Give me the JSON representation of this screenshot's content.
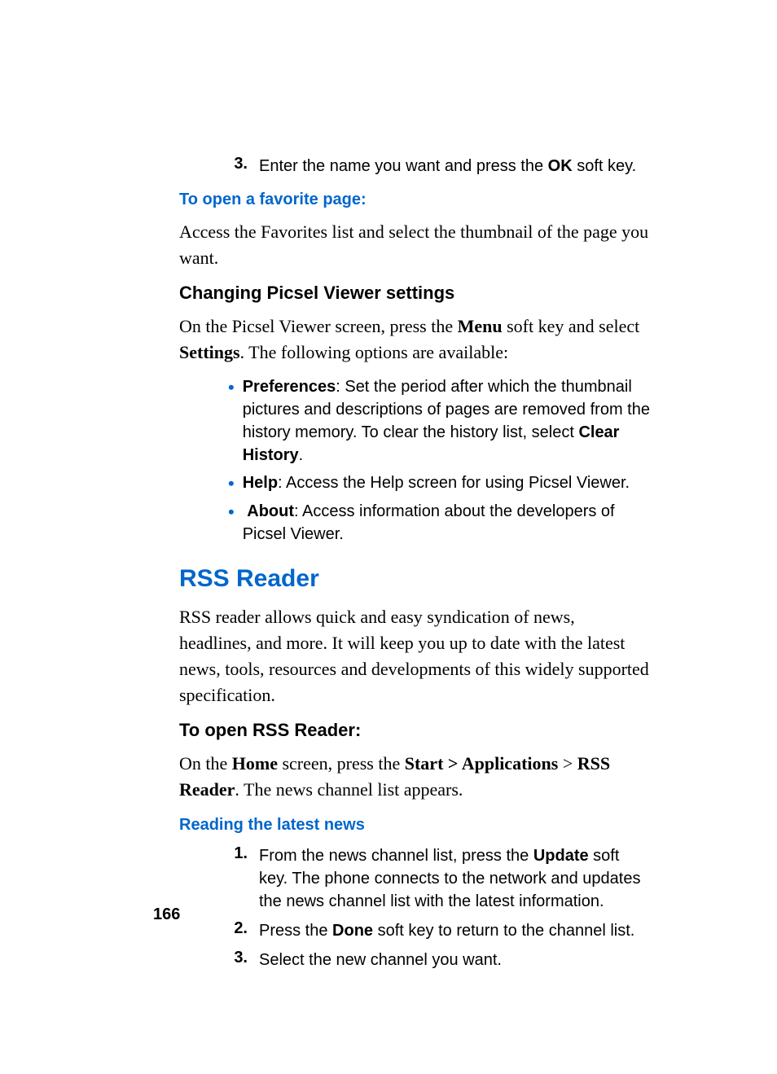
{
  "step3": {
    "num": "3.",
    "pre": "Enter the name you want and press the ",
    "bold": "OK",
    "post": " soft key."
  },
  "subheading_favorite": "To open a favorite page:",
  "favorite_body": "Access the Favorites list and select the thumbnail of the page you want.",
  "heading_changing": "Changing Picsel Viewer settings",
  "changing_body": {
    "pre1": "On the Picsel Viewer screen, press the ",
    "b1": "Menu",
    "mid1": " soft key and select ",
    "b2": "Settings",
    "post1": ". The following options are available:"
  },
  "bullets": {
    "preferences": {
      "label": "Preferences",
      "text1": ": Set the period after which the thumbnail pictures and descriptions of pages are removed from the history memory. To clear the history list, select ",
      "bold": "Clear History",
      "post": "."
    },
    "help": {
      "label": "Help",
      "text": ": Access the Help screen for using Picsel Viewer."
    },
    "about": {
      "label": "About",
      "text": ": Access information about the developers of Picsel Viewer."
    }
  },
  "section_rss": "RSS Reader",
  "rss_body": "RSS reader allows quick and easy syndication of news, headlines, and more. It will keep you up to date with the latest news, tools, resources and developments of this widely supported specification.",
  "heading_open_rss": "To open RSS Reader:",
  "open_rss_body": {
    "pre": "On the ",
    "b1": "Home",
    "mid1": " screen, press the ",
    "b2": "Start > Applications",
    "mid2": " > ",
    "b3": "RSS Reader",
    "post": ". The news channel list appears."
  },
  "subheading_reading": "Reading the latest news",
  "reading_steps": {
    "s1": {
      "num": "1.",
      "pre": "From the news channel list, press the ",
      "bold": "Update",
      "post": " soft key. The phone connects to the network and updates the news channel list with the latest information."
    },
    "s2": {
      "num": "2.",
      "pre": "Press the ",
      "bold": "Done",
      "post": " soft key to return to the channel list."
    },
    "s3": {
      "num": "3.",
      "text": "Select the new channel you want."
    }
  },
  "page_number": "166"
}
